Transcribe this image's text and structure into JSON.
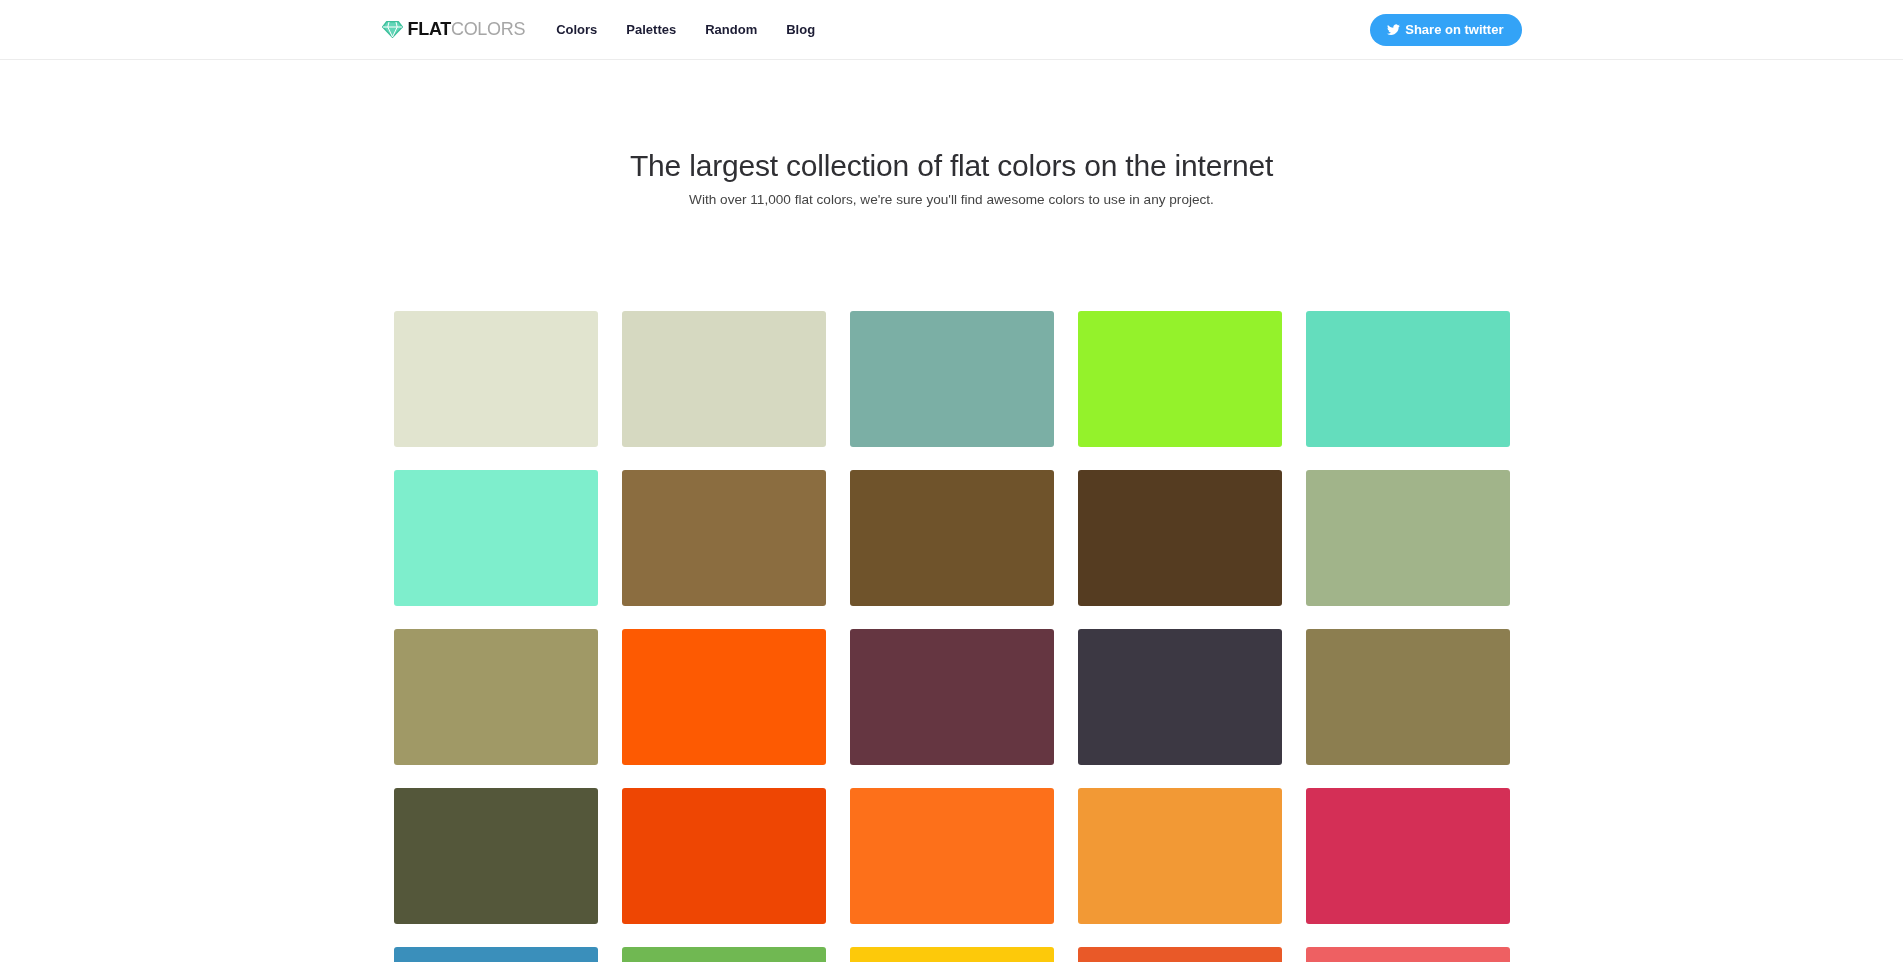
{
  "header": {
    "logo": "**FLAT**COLORS",
    "nav": [
      {
        "label": "Colors"
      },
      {
        "label": "Palettes"
      },
      {
        "label": "Random"
      },
      {
        "label": "Blog"
      }
    ],
    "share_button": "Share on twitter"
  },
  "hero": {
    "title": "The largest collection of flat colors on the internet",
    "subtitle": "With over 11,000 flat colors, we're sure you'll find awesome colors to use in any project."
  },
  "swatches": [
    {
      "color": "#e1e4cf"
    },
    {
      "color": "#d6d9c1"
    },
    {
      "color": "#7bafa5"
    },
    {
      "color": "#94f22b"
    },
    {
      "color": "#64ddbd"
    },
    {
      "color": "#7eeecc"
    },
    {
      "color": "#8b6d40"
    },
    {
      "color": "#6f532b"
    },
    {
      "color": "#553c21"
    },
    {
      "color": "#a1b48a"
    },
    {
      "color": "#a09966"
    },
    {
      "color": "#fd5a02"
    },
    {
      "color": "#653641"
    },
    {
      "color": "#3c3843"
    },
    {
      "color": "#8c7e50"
    },
    {
      "color": "#54573a"
    },
    {
      "color": "#ee4603"
    },
    {
      "color": "#fd701a"
    },
    {
      "color": "#f29935"
    },
    {
      "color": "#d42f56"
    },
    {
      "color": "#3a8fbb"
    },
    {
      "color": "#70b852"
    },
    {
      "color": "#fdc90a"
    },
    {
      "color": "#e95928"
    },
    {
      "color": "#ee6062"
    }
  ]
}
